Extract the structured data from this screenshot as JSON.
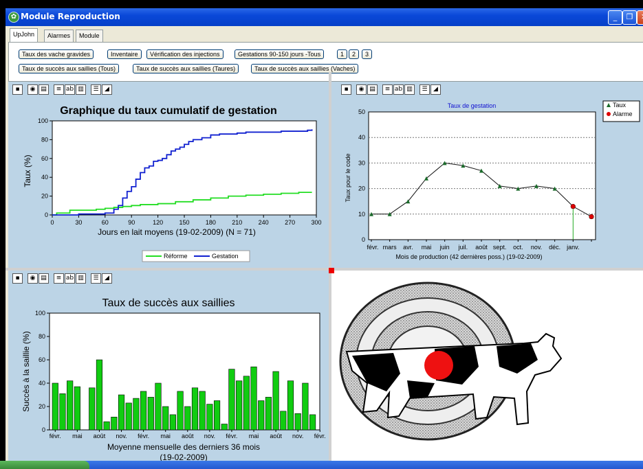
{
  "window": {
    "title": "Module Reproduction",
    "controls": [
      "_",
      "❐",
      "✕"
    ]
  },
  "tabs": [
    {
      "label": "UpJohn",
      "active": true
    },
    {
      "label": "Alarmes",
      "active": false
    },
    {
      "label": "Module Repro",
      "active": false
    }
  ],
  "buttons_row1": [
    "Taux des vache gravides",
    "Inventaire",
    "Vérification des injections",
    "Gestations 90-150 jours -Tous",
    "1",
    "2",
    "3"
  ],
  "buttons_row2": [
    "Taux de succès aux saillies (Tous)",
    "Taux de succès aux saillies (Taures)",
    "Taux de succès aux saillies (Vaches)"
  ],
  "toolbar_icons": [
    "save-icon",
    "camera-icon",
    "print-icon",
    "page-icon",
    "abc-icon",
    "grid-icon",
    "list-icon",
    "chart-tool-icon"
  ],
  "chart_data": [
    {
      "type": "line",
      "title": "Graphique du taux cumulatif de gestation",
      "xlabel": "Jours en lait moyens  (19-02-2009) (N = 71)",
      "ylabel": "Taux  (%)",
      "xlim": [
        0,
        300
      ],
      "ylim": [
        0,
        100
      ],
      "xticks": [
        0,
        30,
        60,
        90,
        120,
        150,
        180,
        210,
        240,
        270,
        300
      ],
      "yticks": [
        0,
        20,
        40,
        60,
        80,
        100
      ],
      "legend": "bottom-center",
      "series": [
        {
          "name": "Réforme",
          "color": "#22dd22",
          "x": [
            0,
            5,
            10,
            20,
            30,
            50,
            60,
            70,
            80,
            90,
            100,
            120,
            140,
            160,
            180,
            200,
            220,
            240,
            260,
            280,
            295
          ],
          "y": [
            0,
            2,
            2,
            5,
            5,
            6,
            7,
            8,
            9,
            10,
            11,
            12,
            14,
            16,
            18,
            20,
            21,
            22,
            23,
            24,
            24
          ]
        },
        {
          "name": "Gestation",
          "color": "#1020d0",
          "x": [
            0,
            30,
            60,
            70,
            75,
            80,
            85,
            90,
            95,
            100,
            105,
            110,
            115,
            120,
            125,
            130,
            135,
            140,
            145,
            150,
            155,
            160,
            170,
            180,
            190,
            200,
            210,
            220,
            230,
            240,
            250,
            260,
            270,
            280,
            290,
            295
          ],
          "y": [
            0,
            1,
            2,
            6,
            10,
            18,
            25,
            30,
            38,
            45,
            50,
            52,
            57,
            58,
            60,
            64,
            68,
            70,
            72,
            75,
            78,
            80,
            82,
            85,
            86,
            86,
            87,
            88,
            88,
            88,
            88,
            89,
            89,
            89,
            90,
            91
          ]
        }
      ]
    },
    {
      "type": "line",
      "title": "Taux de gestation",
      "xlabel": "Mois de production (42 dernières poss.) (19-02-2009)",
      "ylabel": "Taux pour le code",
      "ylim": [
        0,
        50
      ],
      "yticks": [
        0,
        10,
        20,
        30,
        40,
        50
      ],
      "grid": true,
      "legend": "right",
      "categories": [
        "févr.",
        "mars",
        "avr.",
        "mai",
        "juin",
        "juil.",
        "août",
        "sept.",
        "oct.",
        "nov.",
        "déc.",
        "janv.",
        ""
      ],
      "series": [
        {
          "name": "Taux",
          "color": "#1a6b2a",
          "values": [
            10,
            10,
            15,
            24,
            30,
            29,
            27,
            21,
            20,
            21,
            20,
            13,
            9
          ]
        },
        {
          "name": "Alarme",
          "color": "#dd0000",
          "values": [
            null,
            null,
            null,
            null,
            null,
            null,
            null,
            null,
            null,
            null,
            null,
            13,
            9
          ]
        }
      ]
    },
    {
      "type": "bar",
      "title": "Taux de succès aux saillies",
      "xlabel": "Moyenne mensuelle des derniers 36 mois",
      "xlabel2": "(19-02-2009)",
      "ylabel": "Succès à la saillie (%)",
      "ylim": [
        0,
        100
      ],
      "yticks": [
        0,
        20,
        40,
        60,
        80,
        100
      ],
      "color": "#11cc11",
      "tick_labels": [
        "févr.",
        "mai",
        "août",
        "nov.",
        "févr.",
        "mai",
        "août",
        "nov.",
        "févr.",
        "mai",
        "août",
        "nov.",
        "févr."
      ],
      "values": [
        40,
        31,
        42,
        37,
        0,
        36,
        60,
        7,
        11,
        30,
        23,
        27,
        33,
        28,
        40,
        20,
        13,
        33,
        20,
        36,
        33,
        22,
        25,
        5,
        52,
        42,
        46,
        54,
        25,
        28,
        50,
        16,
        42,
        14,
        40,
        13
      ]
    }
  ],
  "logo": {
    "name": "cow-target-logo"
  }
}
